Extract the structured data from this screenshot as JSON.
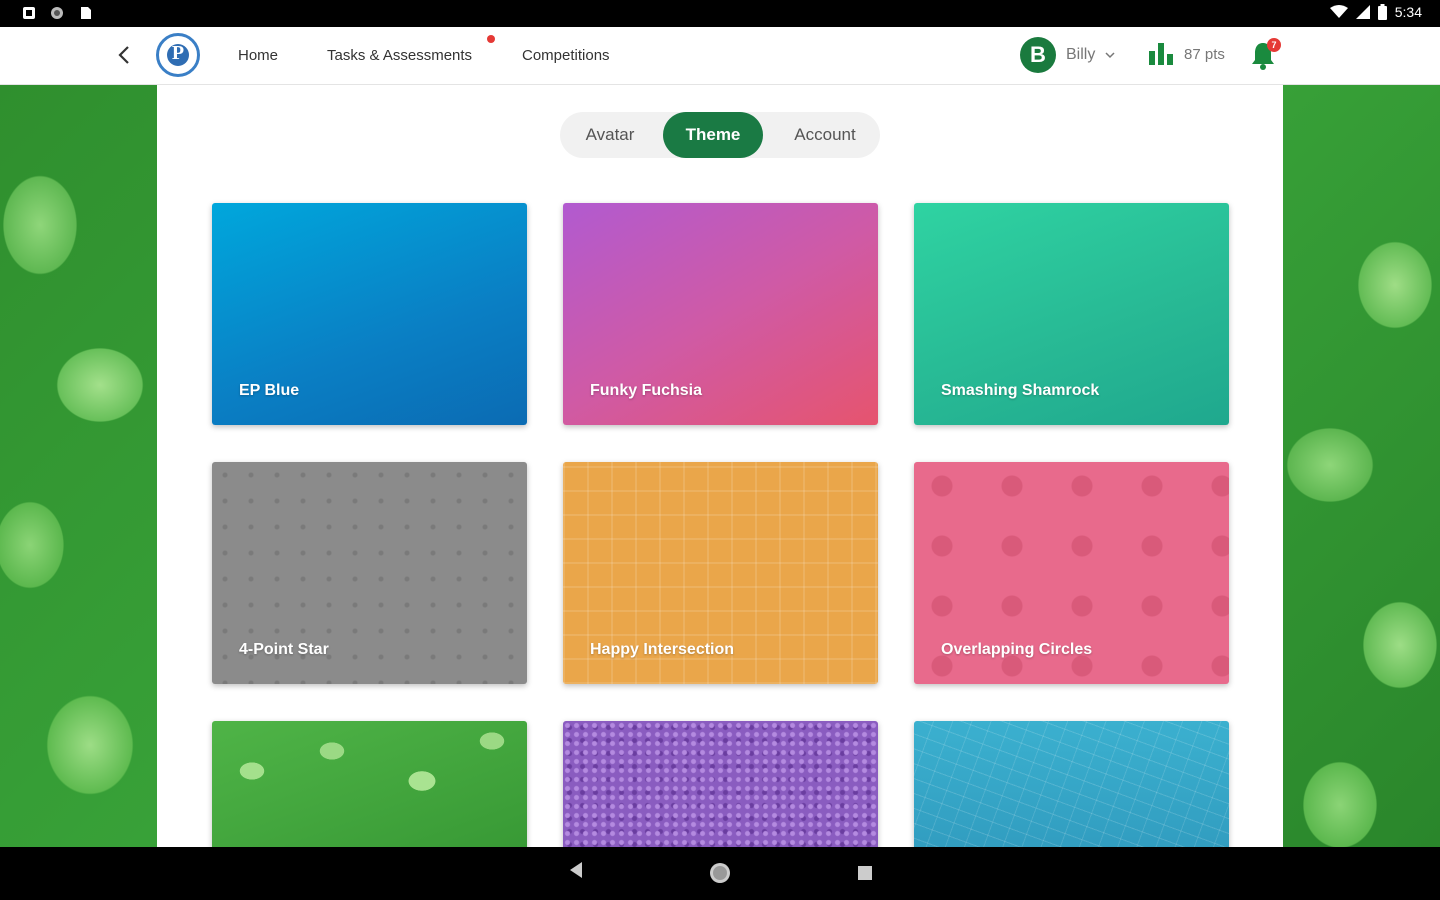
{
  "status_bar": {
    "time": "5:34",
    "icons": [
      "notification-icon",
      "record-icon",
      "sd-card-icon",
      "wifi-icon",
      "signal-icon",
      "battery-icon"
    ]
  },
  "nav": {
    "links": [
      {
        "label": "Home"
      },
      {
        "label": "Tasks & Assessments"
      },
      {
        "label": "Competitions"
      }
    ],
    "user": {
      "initial": "B",
      "name": "Billy"
    },
    "points": "87 pts",
    "notification_count": "7"
  },
  "tabs": [
    {
      "label": "Avatar",
      "active": false
    },
    {
      "label": "Theme",
      "active": true
    },
    {
      "label": "Account",
      "active": false
    }
  ],
  "themes": [
    {
      "label": "EP Blue"
    },
    {
      "label": "Funky Fuchsia"
    },
    {
      "label": "Smashing Shamrock"
    },
    {
      "label": "4-Point Star"
    },
    {
      "label": "Happy Intersection"
    },
    {
      "label": "Overlapping Circles"
    },
    {
      "label": ""
    },
    {
      "label": ""
    },
    {
      "label": ""
    }
  ],
  "colors": {
    "accent": "#1a7a44",
    "notification": "#e53935",
    "points_icon": "#1a8a3e"
  }
}
